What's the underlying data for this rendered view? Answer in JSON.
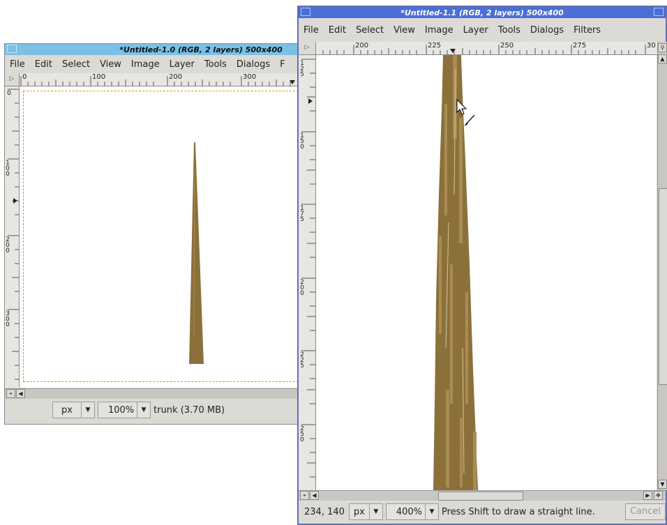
{
  "colors": {
    "title_left": "#7cc0e6",
    "title_right": "#4a6fd6",
    "trunk": "#8c703a",
    "trunk_light": "#a88c54"
  },
  "menu_items": [
    "File",
    "Edit",
    "Select",
    "View",
    "Image",
    "Layer",
    "Tools",
    "Dialogs",
    "Filters"
  ],
  "window_left": {
    "title": "*Untitled-1.0 (RGB, 2 layers) 500x400",
    "menu": [
      "File",
      "Edit",
      "Select",
      "View",
      "Image",
      "Layer",
      "Tools",
      "Dialogs",
      "F"
    ],
    "ruler_h": [
      "0",
      "100",
      "200",
      "300"
    ],
    "ruler_v": [
      "0",
      "100",
      "200",
      "300"
    ],
    "unit": "px",
    "zoom": "100%",
    "status": "trunk (3.70 MB)"
  },
  "window_right": {
    "title": "*Untitled-1.1 (RGB, 2 layers) 500x400",
    "menu": [
      "File",
      "Edit",
      "Select",
      "View",
      "Image",
      "Layer",
      "Tools",
      "Dialogs",
      "Filters"
    ],
    "ruler_h": [
      "200",
      "225",
      "250",
      "275",
      "30"
    ],
    "ruler_v": [
      "125",
      "150",
      "175",
      "200",
      "225",
      "250"
    ],
    "coords": "234, 140",
    "unit": "px",
    "zoom": "400%",
    "status": "Press Shift to draw a straight line.",
    "cancel": "Cancel"
  },
  "icons": {
    "navigate": "navigate-icon",
    "cursor": "pointer-cursor-icon",
    "paintbrush": "paintbrush-cursor-icon"
  }
}
